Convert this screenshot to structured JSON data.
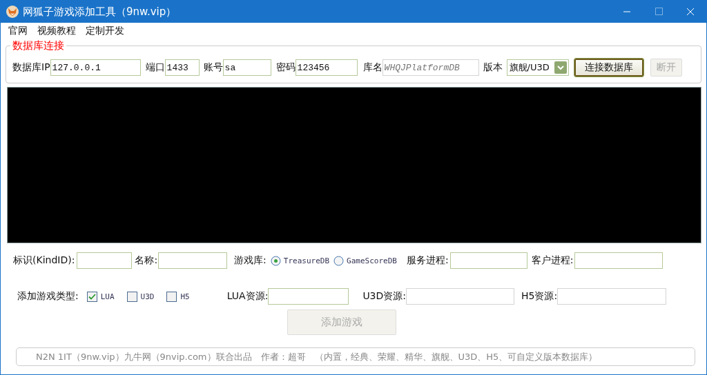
{
  "window": {
    "title": "网狐子游戏添加工具（9nw.vip）"
  },
  "menu": [
    "官网",
    "视频教程",
    "定制开发"
  ],
  "db_group": {
    "title": "数据库连接",
    "fields": [
      {
        "label": "数据库IP",
        "value": "127.0.0.1",
        "disabled": false
      },
      {
        "label": "端口",
        "value": "1433",
        "disabled": false
      },
      {
        "label": "账号",
        "value": "sa",
        "disabled": false
      },
      {
        "label": "密码",
        "value": "123456",
        "disabled": false
      },
      {
        "label": "库名",
        "value": "WHQJPlatformDB",
        "disabled": true
      }
    ],
    "version": {
      "label": "版本",
      "value": "旗舰/U3D"
    },
    "buttons": [
      {
        "label": "连接数据库",
        "disabled": false
      },
      {
        "label": "断开",
        "disabled": true
      }
    ]
  },
  "game_form": {
    "kind_id": {
      "label": "标识(KindID):"
    },
    "name": {
      "label": "名称:"
    },
    "game_db": {
      "label": "游戏库:",
      "options": [
        {
          "label": "TreasureDB",
          "selected": true
        },
        {
          "label": "GameScoreDB",
          "selected": false
        }
      ]
    },
    "server_process": {
      "label": "服务进程:"
    },
    "client_process": {
      "label": "客户进程:"
    },
    "game_types": {
      "label": "添加游戏类型:",
      "options": [
        {
          "label": "LUA",
          "checked": true
        },
        {
          "label": "U3D",
          "checked": false
        },
        {
          "label": "H5",
          "checked": false
        }
      ]
    },
    "resources": [
      {
        "label": "LUA资源:",
        "disabled": false
      },
      {
        "label": "U3D资源:",
        "disabled": true
      },
      {
        "label": "H5资源:",
        "disabled": true
      }
    ],
    "add_button": {
      "label": "添加游戏",
      "disabled": true
    }
  },
  "footer": "N2N 1IT（9nw.vip）九牛网（9nvip.com）联合出品　作者：超哥　（内置，经典、荣耀、精华、旗舰、U3D、H5、可自定义版本数据库）"
}
